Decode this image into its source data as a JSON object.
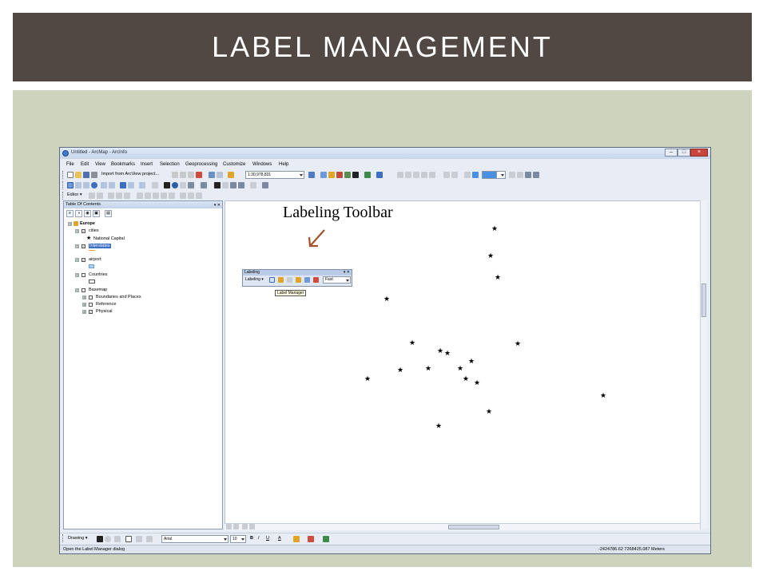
{
  "slide": {
    "title": "LABEL MANAGEMENT",
    "annotation": "Labeling Toolbar",
    "colors": {
      "title_bar": "#524843",
      "content_bg": "#cdd3bd",
      "arrow": "#a0522d"
    }
  },
  "window": {
    "title": "Untitled - ArcMap - ArcInfo",
    "menus": [
      "File",
      "Edit",
      "View",
      "Bookmarks",
      "Insert",
      "Selection",
      "Geoprocessing",
      "Customize",
      "Windows",
      "Help"
    ],
    "toolbar": {
      "import_label": "Import from ArcView project...",
      "scale": "1:30,978,831",
      "editor_label": "Editor ▾"
    }
  },
  "toc": {
    "header": "Table Of Contents",
    "items": [
      {
        "label": "Europe",
        "level": 0,
        "expand": "⊟",
        "checked": null
      },
      {
        "label": "cities",
        "level": 1,
        "expand": "⊟",
        "checked": true
      },
      {
        "label": "National Capital",
        "level": 2,
        "expand": null,
        "checked": null
      },
      {
        "label": "Interstates",
        "level": 1,
        "expand": "⊟",
        "checked": true
      },
      {
        "label": "airport",
        "level": 1,
        "expand": "⊟",
        "checked": true
      },
      {
        "label": "Countries",
        "level": 1,
        "expand": "⊟",
        "checked": false
      },
      {
        "label": "Basemap",
        "level": 1,
        "expand": "⊟",
        "checked": false
      },
      {
        "label": "Boundaries and Places",
        "level": 2,
        "expand": "⊞",
        "checked": false
      },
      {
        "label": "Reference",
        "level": 2,
        "expand": "⊞",
        "checked": false
      },
      {
        "label": "Physical",
        "level": 2,
        "expand": "⊞",
        "checked": true
      }
    ]
  },
  "labeling_toolbar": {
    "title": "Labeling",
    "dropdown": "Labeling ▾",
    "mode": "Fast",
    "tooltip": "Label Manager"
  },
  "drawing_toolbar": {
    "drawing_label": "Drawing ▾",
    "font": "Arial",
    "font_size": "10",
    "bold": "B",
    "italic": "I",
    "underline": "U",
    "font_color": "A"
  },
  "status": {
    "message": "Open the Label Manager dialog",
    "coordinates": "-2424786.62  7268425.087 Meters"
  }
}
